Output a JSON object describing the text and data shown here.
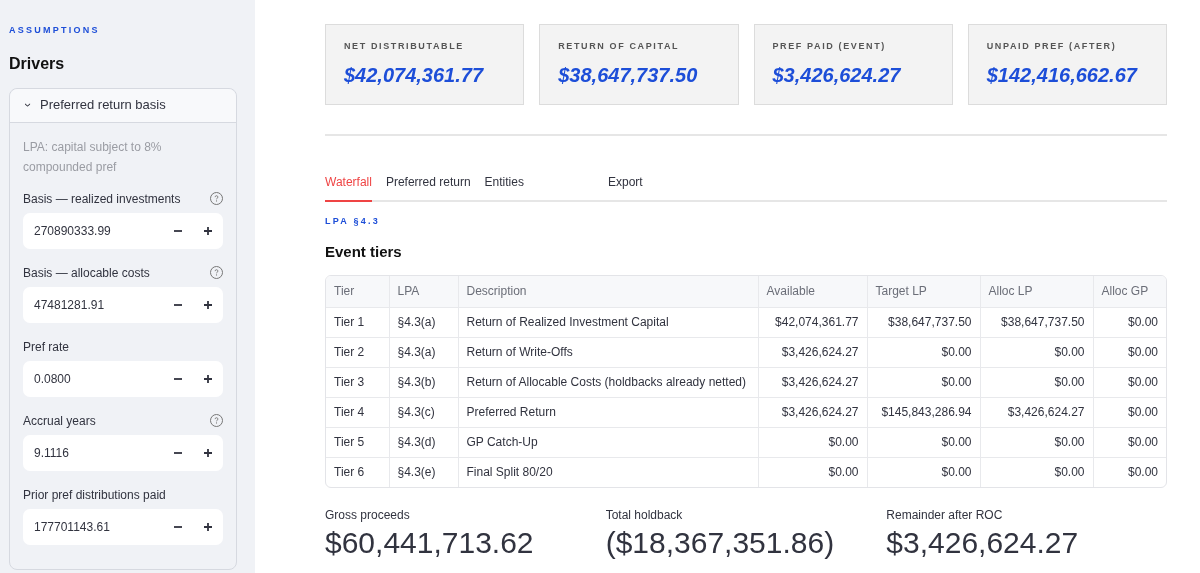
{
  "sidebar": {
    "eyebrow": "ASSUMPTIONS",
    "title": "Drivers",
    "expander": {
      "label": "Preferred return basis",
      "expanded": true,
      "caret": "›",
      "note": "LPA: capital subject to 8% compounded pref",
      "fields": [
        {
          "label": "Basis — realized investments",
          "value": "270890333.99",
          "help": true
        },
        {
          "label": "Basis — allocable costs",
          "value": "47481281.91",
          "help": true
        },
        {
          "label": "Pref rate",
          "value": "0.0800",
          "help": false
        },
        {
          "label": "Accrual years",
          "value": "9.1116",
          "help": true
        },
        {
          "label": "Prior pref distributions paid",
          "value": "177701143.61",
          "help": false
        }
      ]
    }
  },
  "metrics": [
    {
      "label": "NET DISTRIBUTABLE",
      "value": "$42,074,361.77"
    },
    {
      "label": "RETURN OF CAPITAL",
      "value": "$38,647,737.50"
    },
    {
      "label": "PREF PAID (EVENT)",
      "value": "$3,426,624.27"
    },
    {
      "label": "UNPAID PREF (AFTER)",
      "value": "$142,416,662.67"
    }
  ],
  "tabs": [
    {
      "label": "Waterfall",
      "selected": true
    },
    {
      "label": "Preferred return",
      "selected": false
    },
    {
      "label": "Entities",
      "selected": false
    },
    {
      "label": "Export",
      "selected": false
    }
  ],
  "section": {
    "eyebrow": "LPA §4.3",
    "title": "Event tiers"
  },
  "table": {
    "columns": [
      "Tier",
      "LPA",
      "Description",
      "Available",
      "Target LP",
      "Alloc LP",
      "Alloc GP"
    ],
    "rows": [
      [
        "Tier 1",
        "§4.3(a)",
        "Return of Realized Investment Capital",
        "$42,074,361.77",
        "$38,647,737.50",
        "$38,647,737.50",
        "$0.00"
      ],
      [
        "Tier 2",
        "§4.3(a)",
        "Return of Write-Offs",
        "$3,426,624.27",
        "$0.00",
        "$0.00",
        "$0.00"
      ],
      [
        "Tier 3",
        "§4.3(b)",
        "Return of Allocable Costs (holdbacks already netted)",
        "$3,426,624.27",
        "$0.00",
        "$0.00",
        "$0.00"
      ],
      [
        "Tier 4",
        "§4.3(c)",
        "Preferred Return",
        "$3,426,624.27",
        "$145,843,286.94",
        "$3,426,624.27",
        "$0.00"
      ],
      [
        "Tier 5",
        "§4.3(d)",
        "GP Catch-Up",
        "$0.00",
        "$0.00",
        "$0.00",
        "$0.00"
      ],
      [
        "Tier 6",
        "§4.3(e)",
        "Final Split 80/20",
        "$0.00",
        "$0.00",
        "$0.00",
        "$0.00"
      ]
    ]
  },
  "totals": [
    {
      "label": "Gross proceeds",
      "value": "$60,441,713.62"
    },
    {
      "label": "Total holdback",
      "value": "($18,367,351.86)"
    },
    {
      "label": "Remainder after ROC",
      "value": "$3,426,624.27"
    }
  ]
}
